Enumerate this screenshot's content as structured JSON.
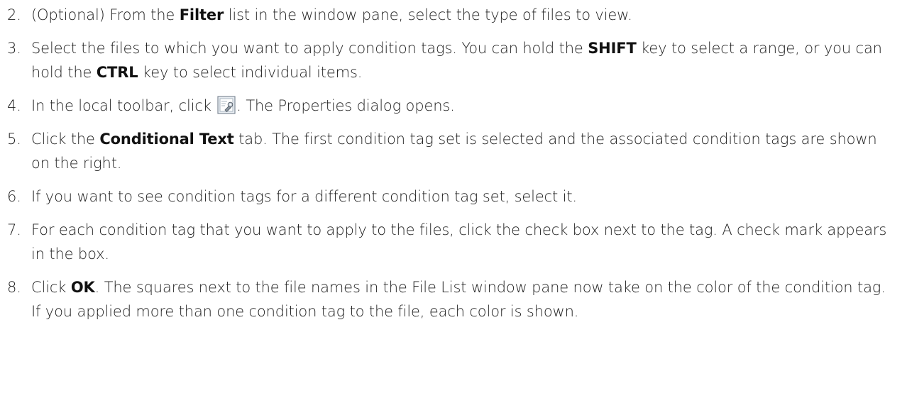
{
  "steps": [
    {
      "number": "2.",
      "parts": [
        "(Optional) From the ",
        "Filter",
        " list in the window pane, select the type of files to view."
      ]
    },
    {
      "number": "3.",
      "parts": [
        "Select the files to which you want to apply condition tags. You can hold the ",
        "SHIFT",
        " key to select a range, or you can hold the ",
        "CTRL",
        " key to select individual items."
      ]
    },
    {
      "number": "4.",
      "before_icon": "In the local toolbar, click ",
      "after_icon": ". The Properties dialog opens.",
      "icon": "properties-icon"
    },
    {
      "number": "5.",
      "parts": [
        "Click the ",
        "Conditional Text",
        " tab. The first condition tag set is selected and the associated condition tags are shown on the right."
      ]
    },
    {
      "number": "6.",
      "text": "If you want to see condition tags for a different condition tag set, select it."
    },
    {
      "number": "7.",
      "text": "For each condition tag that you want to apply to the files, click the check box next to the tag. A check mark appears in the box."
    },
    {
      "number": "8.",
      "parts": [
        "Click ",
        "OK",
        ". The squares next to the file names in the File List window pane now take on the color of the condition tag. If you applied more than one condition tag to the file, each color is shown."
      ]
    }
  ]
}
